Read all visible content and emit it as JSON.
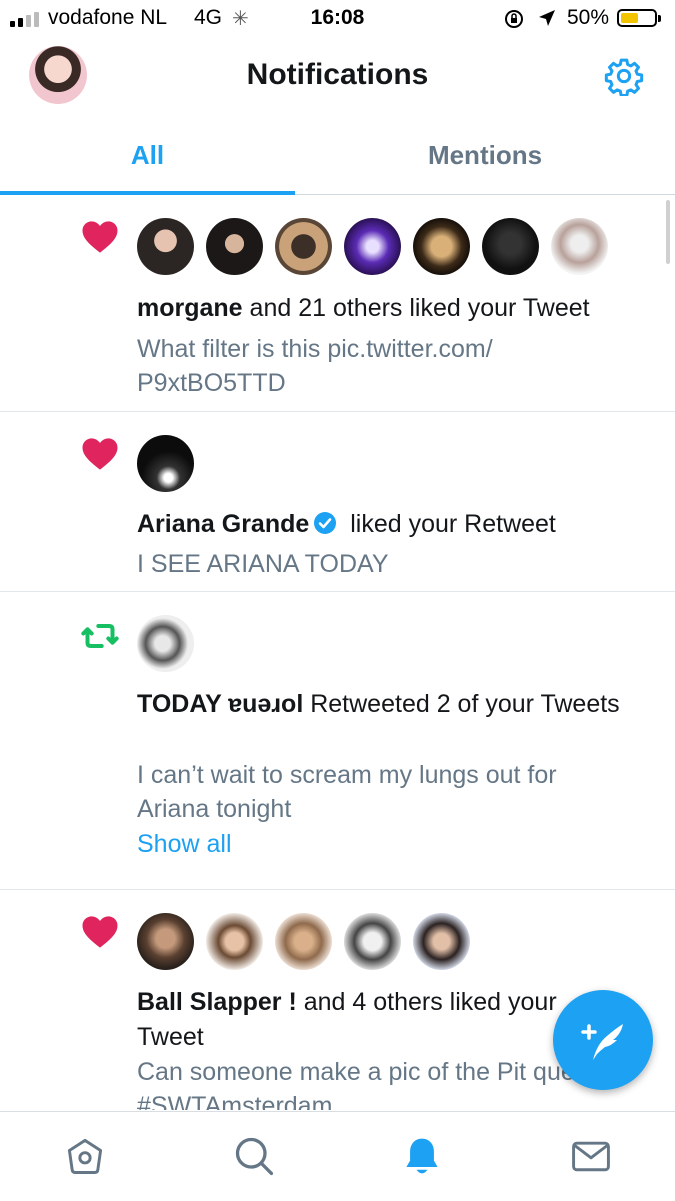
{
  "status_bar": {
    "carrier": "vodafone NL",
    "network": "4G",
    "time": "16:08",
    "battery": "50%",
    "battery_level": 0.5,
    "icons": [
      "signal-icon",
      "loading-spinner-icon",
      "orientation-lock-icon",
      "location-arrow-icon",
      "battery-icon"
    ]
  },
  "header": {
    "title": "Notifications",
    "icons": [
      "profile-avatar",
      "gear-icon"
    ]
  },
  "tabs": [
    {
      "label": "All",
      "active": true
    },
    {
      "label": "Mentions",
      "active": false
    }
  ],
  "notifications": [
    {
      "type": "like",
      "icon": "heart-icon",
      "actor": "morgane",
      "action": " and 21 others liked your Tweet",
      "preview": "What filter is this pic.twitter.com/ P9xtBO5TTD",
      "avatar_count": 7
    },
    {
      "type": "like",
      "icon": "heart-icon",
      "actor": "Ariana Grande",
      "verified": true,
      "action": " liked your Retweet",
      "preview": "I SEE ARIANA TODAY",
      "avatar_count": 1
    },
    {
      "type": "retweet",
      "icon": "retweet-icon",
      "actor": "TODAY ɐuǝɹol",
      "action": " Retweeted 2 of your Tweets",
      "preview": "I can’t wait to scream my lungs out for Ariana tonight",
      "show_all": "Show all",
      "avatar_count": 1
    },
    {
      "type": "like",
      "icon": "heart-icon",
      "actor": "Ball Slapper !",
      "action": " and 4 others liked your Tweet",
      "preview": "Can someone make a pic of the Pit queue. #SWTAmsterdam",
      "avatar_count": 5
    }
  ],
  "fab": {
    "icon": "compose-tweet-icon"
  },
  "bottom_nav": [
    {
      "icon": "home-icon",
      "active": false
    },
    {
      "icon": "search-icon",
      "active": false
    },
    {
      "icon": "bell-icon",
      "active": true
    },
    {
      "icon": "mail-icon",
      "active": false
    }
  ],
  "colors": {
    "accent": "#1da1f2",
    "like": "#e0245e",
    "retweet": "#17bf63",
    "secondary_text": "#657786"
  }
}
